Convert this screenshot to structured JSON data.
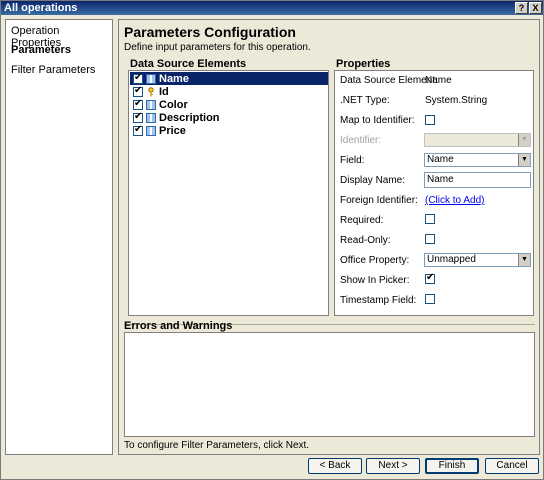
{
  "window": {
    "title": "All operations",
    "help_label": "?",
    "close_label": "X"
  },
  "nav": {
    "items": [
      {
        "label": "Operation Properties"
      },
      {
        "label": "Parameters"
      },
      {
        "label": "Filter Parameters"
      }
    ]
  },
  "main": {
    "title": "Parameters Configuration",
    "subtitle": "Define input parameters for this operation.",
    "data_source_header": "Data Source Elements",
    "properties_header": "Properties",
    "errors_header": "Errors and Warnings",
    "footer_text": "To configure Filter Parameters, click Next."
  },
  "tree": {
    "items": [
      {
        "label": "Name",
        "checked": true,
        "icon": "field-icon",
        "selected": true
      },
      {
        "label": "Id",
        "checked": true,
        "icon": "key-icon",
        "selected": false
      },
      {
        "label": "Color",
        "checked": true,
        "icon": "field-icon",
        "selected": false
      },
      {
        "label": "Description",
        "checked": true,
        "icon": "field-icon",
        "selected": false
      },
      {
        "label": "Price",
        "checked": true,
        "icon": "field-icon",
        "selected": false
      }
    ]
  },
  "properties": {
    "data_source_element_label": "Data Source Element:",
    "data_source_element_value": "Name",
    "net_type_label": ".NET Type:",
    "net_type_value": "System.String",
    "map_to_identifier_label": "Map to Identifier:",
    "identifier_label": "Identifier:",
    "field_label": "Field:",
    "field_value": "Name",
    "display_name_label": "Display Name:",
    "display_name_value": "Name",
    "foreign_identifier_label": "Foreign Identifier:",
    "foreign_identifier_link": "(Click to Add)",
    "required_label": "Required:",
    "read_only_label": "Read-Only:",
    "office_property_label": "Office Property:",
    "office_property_value": "Unmapped",
    "show_in_picker_label": "Show In Picker:",
    "timestamp_field_label": "Timestamp Field:",
    "map_to_identifier_checked": false,
    "required_checked": false,
    "read_only_checked": false,
    "show_in_picker_checked": true,
    "timestamp_field_checked": false
  },
  "buttons": {
    "back": "< Back",
    "next": "Next >",
    "finish": "Finish",
    "cancel": "Cancel"
  },
  "colors": {
    "selection": "#0a246a",
    "link": "#0000ee",
    "panel_bg": "#ece9d8"
  }
}
